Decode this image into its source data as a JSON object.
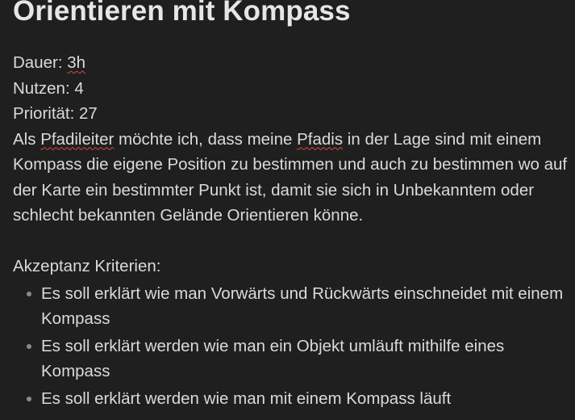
{
  "title": "Orientieren mit Kompass",
  "meta": {
    "duration": {
      "label": "Dauer: ",
      "value": "3h"
    },
    "benefit": {
      "label": "Nutzen: ",
      "value": "4"
    },
    "priority": {
      "label": "Priorität: ",
      "value": "27"
    }
  },
  "story": {
    "part1": "Als ",
    "word1": "Pfadileiter",
    "part2": " möchte ich, dass meine ",
    "word2": "Pfadis",
    "part3": " in der Lage sind mit einem Kompass die eigene Position zu bestimmen und auch zu bestimmen wo auf der Karte ein bestimmter Punkt ist, damit sie sich in Unbekanntem oder schlecht bekannten Gelände Orientieren könne."
  },
  "criteria": {
    "heading": "Akzeptanz Kriterien:",
    "items": [
      "Es soll erklärt wie man Vorwärts und Rückwärts einschneidet mit einem Kompass",
      "Es soll erklärt werden wie man ein Objekt umläuft mithilfe eines Kompass",
      "Es soll erklärt werden wie man mit einem Kompass läuft"
    ]
  },
  "colors": {
    "background": "#1f1f1f",
    "text": "#dadada",
    "spellcheck_underline": "#e0463c"
  }
}
